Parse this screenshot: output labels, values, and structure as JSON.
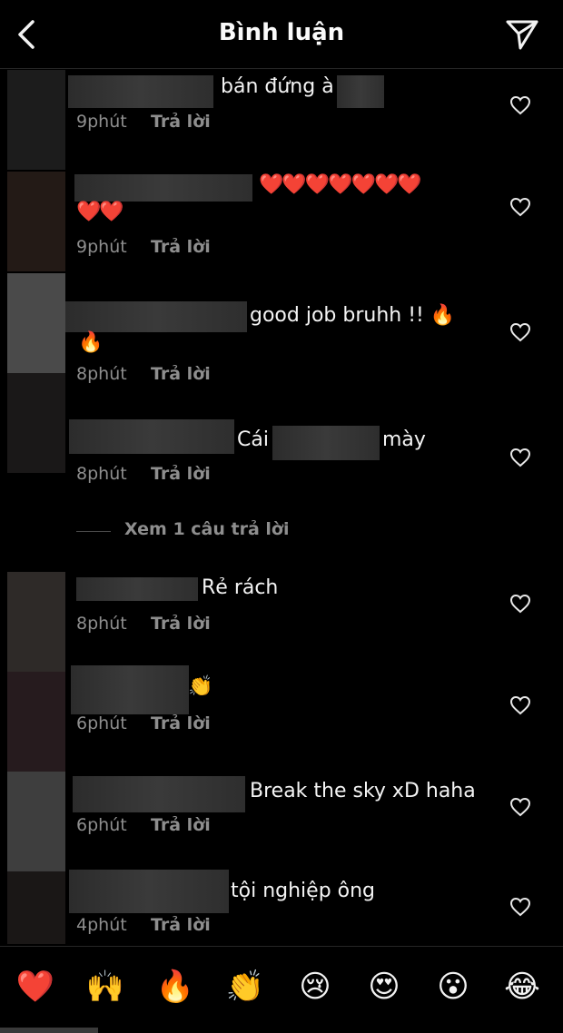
{
  "header": {
    "title": "Bình luận"
  },
  "comments": [
    {
      "text": "bán đứng à",
      "time": "9phút",
      "reply": "Trả lời"
    },
    {
      "text": "❤️❤️❤️❤️❤️❤️❤️",
      "text2": "❤️❤️",
      "time": "9phút",
      "reply": "Trả lời"
    },
    {
      "text": "good job bruhh !! 🔥",
      "text2": "🔥",
      "time": "8phút",
      "reply": "Trả lời"
    },
    {
      "text_a": "Cái",
      "text_b": "mày",
      "time": "8phút",
      "reply": "Trả lời"
    },
    {
      "text": "Rẻ rách",
      "time": "8phút",
      "reply": "Trả lời"
    },
    {
      "text": "👏",
      "time": "6phút",
      "reply": "Trả lời"
    },
    {
      "text": "Break the sky xD haha",
      "time": "6phút",
      "reply": "Trả lời"
    },
    {
      "text": "tội nghiệp ông",
      "time": "4phút",
      "reply": "Trả lời"
    }
  ],
  "view_replies": "Xem 1 câu trả lời",
  "emoji_bar": [
    "❤️",
    "🙌",
    "🔥",
    "👏",
    "😢",
    "😍",
    "😮",
    "😂"
  ],
  "colors": {
    "background": "#000000",
    "secondary_text": "#8e8e8e",
    "primary_text": "#f2f2f2"
  }
}
